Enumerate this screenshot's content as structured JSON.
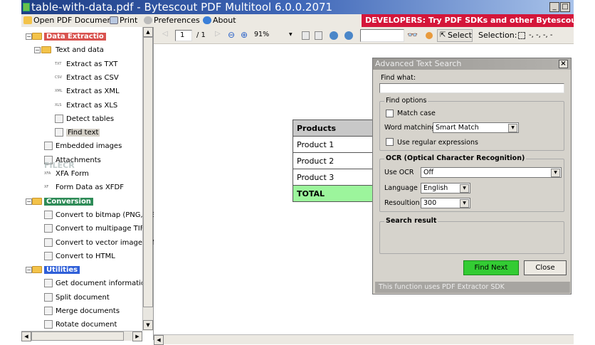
{
  "window": {
    "title": "table-with-data.pdf - Bytescout PDF Multitool 6.0.0.2071",
    "minimize": "_",
    "maximize": "□"
  },
  "menu": {
    "open": "Open PDF Document",
    "print": "Print",
    "preferences": "Preferences",
    "about": "About",
    "banner": "DEVELOPERS: Try PDF SDKs and other Bytescout produc"
  },
  "toolbar": {
    "page": "1",
    "page_total": "/ 1",
    "zoom": "91%",
    "search_value": "",
    "select_label": "Select",
    "selection_label": "Selection:",
    "selection_value": "-, -, -, -"
  },
  "tree": [
    {
      "label": "Data Extractio",
      "level": 0,
      "group": true,
      "highlight": "#d9534f"
    },
    {
      "label": "Text and data",
      "level": 1,
      "group": true
    },
    {
      "label": "Extract as TXT",
      "level": 2,
      "tag": "TXT"
    },
    {
      "label": "Extract as CSV",
      "level": 2,
      "tag": "CSV"
    },
    {
      "label": "Extract as XML",
      "level": 2,
      "tag": "XML"
    },
    {
      "label": "Extract as XLS",
      "level": 2,
      "tag": "XLS"
    },
    {
      "label": "Detect tables",
      "level": 2,
      "icon": "table-icon"
    },
    {
      "label": "Find text",
      "level": 2,
      "icon": "binoculars-icon",
      "selected": true
    },
    {
      "label": "Embedded images",
      "level": 1,
      "icon": "image-icon"
    },
    {
      "label": "Attachments",
      "level": 1,
      "icon": "paperclip-icon"
    },
    {
      "label": "XFA Form",
      "level": 1,
      "tag": "XFA"
    },
    {
      "label": "Form Data as XFDF",
      "level": 1,
      "tag": "XF"
    },
    {
      "label": "Conversion",
      "level": 0,
      "group": true,
      "highlight": "#2e8b57"
    },
    {
      "label": "Convert to bitmap (PNG, JPEG,",
      "level": 1,
      "icon": "bitmap-icon"
    },
    {
      "label": "Convert to multipage TIFF",
      "level": 1,
      "icon": "tiff-icon"
    },
    {
      "label": "Convert to vector image (EMF)",
      "level": 1,
      "icon": "emf-icon"
    },
    {
      "label": "Convert to HTML",
      "level": 1,
      "icon": "html-icon"
    },
    {
      "label": "Utilities",
      "level": 0,
      "group": true,
      "highlight": "#2f5fd8"
    },
    {
      "label": "Get document information",
      "level": 1,
      "icon": "info-icon"
    },
    {
      "label": "Split document",
      "level": 1,
      "icon": "split-icon"
    },
    {
      "label": "Merge documents",
      "level": 1,
      "icon": "merge-icon"
    },
    {
      "label": "Rotate document",
      "level": 1,
      "icon": "rotate-icon"
    }
  ],
  "watermark": "FILECR",
  "document": {
    "table": {
      "header": "Products",
      "rows": [
        "Product 1",
        "Product 2",
        "Product 3"
      ],
      "total": "TOTAL"
    },
    "total_color": "#9cf59c"
  },
  "dialog": {
    "title": "Advanced Text Search",
    "close": "×",
    "find_what_label": "Find what:",
    "find_what_value": "",
    "find_options_label": "Find options",
    "match_case": "Match case",
    "match_case_checked": false,
    "word_matching_label": "Word matching",
    "word_matching_value": "Smart Match",
    "regex": "Use regular expressions",
    "regex_checked": false,
    "ocr_label": "OCR (Optical Character Recognition)",
    "use_ocr_label": "Use OCR",
    "use_ocr_value": "Off",
    "language_label": "Language",
    "language_value": "English",
    "resolution_label": "Resoultion",
    "resolution_value": "300",
    "search_result_label": "Search result",
    "find_next": "Find Next",
    "close_button": "Close",
    "footer": "This function uses PDF Extractor SDK",
    "find_next_color": "#33cc33"
  }
}
